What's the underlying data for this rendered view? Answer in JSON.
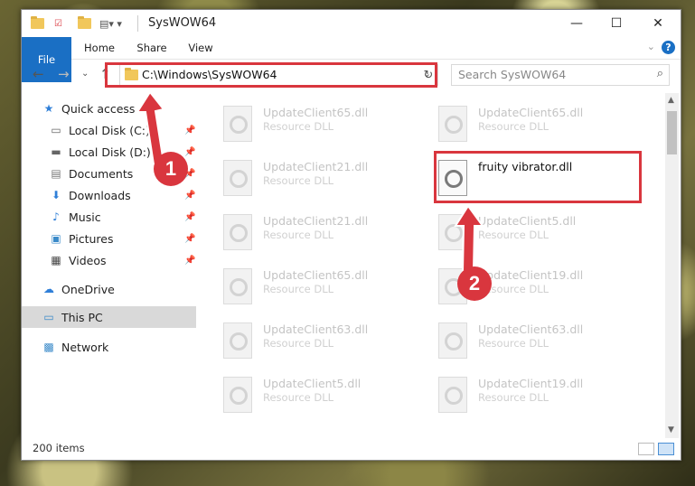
{
  "window": {
    "title": "SysWOW64",
    "minimize": "—",
    "maximize": "☐",
    "close": "✕"
  },
  "ribbon": {
    "file": "File",
    "home": "Home",
    "share": "Share",
    "view": "View",
    "help": "?"
  },
  "address": {
    "path": "C:\\Windows\\SysWOW64",
    "search_placeholder": "Search SysWOW64"
  },
  "sidebar": {
    "quick_access": "Quick access",
    "items": [
      {
        "label": "Local Disk (C:)",
        "pinned": true
      },
      {
        "label": "Local Disk (D:)",
        "pinned": true
      },
      {
        "label": "Documents",
        "pinned": true
      },
      {
        "label": "Downloads",
        "pinned": true
      },
      {
        "label": "Music",
        "pinned": true
      },
      {
        "label": "Pictures",
        "pinned": true
      },
      {
        "label": "Videos",
        "pinned": true
      }
    ],
    "onedrive": "OneDrive",
    "thispc": "This PC",
    "network": "Network"
  },
  "files": {
    "col1": [
      {
        "name": "UpdateClient65.dll",
        "desc": "Resource DLL"
      },
      {
        "name": "UpdateClient21.dll",
        "desc": "Resource DLL"
      },
      {
        "name": "UpdateClient21.dll",
        "desc": "Resource DLL"
      },
      {
        "name": "UpdateClient65.dll",
        "desc": "Resource DLL"
      },
      {
        "name": "UpdateClient63.dll",
        "desc": "Resource DLL"
      },
      {
        "name": "UpdateClient5.dll",
        "desc": "Resource DLL"
      }
    ],
    "col2": [
      {
        "name": "UpdateClient65.dll",
        "desc": "Resource DLL"
      },
      {
        "name": "fruity vibrator.dll",
        "desc": ""
      },
      {
        "name": "UpdateClient5.dll",
        "desc": "Resource DLL"
      },
      {
        "name": "UpdateClient19.dll",
        "desc": "Resource DLL"
      },
      {
        "name": "UpdateClient63.dll",
        "desc": "Resource DLL"
      },
      {
        "name": "UpdateClient19.dll",
        "desc": "Resource DLL"
      }
    ]
  },
  "status": {
    "count": "200 items"
  },
  "annotations": {
    "step1": "1",
    "step2": "2",
    "accent": "#d9363e"
  }
}
